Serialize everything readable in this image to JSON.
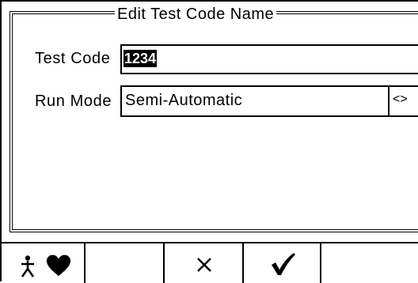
{
  "dialog": {
    "title": "Edit Test Code Name"
  },
  "fields": {
    "test_code": {
      "label": "Test Code",
      "value": "1234"
    },
    "run_mode": {
      "label": "Run Mode",
      "value": "Semi-Automatic",
      "toggle_label": "<>"
    }
  },
  "softkeys": [
    {
      "icon": "person-heart-icon"
    },
    {
      "icon": ""
    },
    {
      "icon": "close-icon"
    },
    {
      "icon": "check-icon"
    },
    {
      "icon": ""
    }
  ]
}
